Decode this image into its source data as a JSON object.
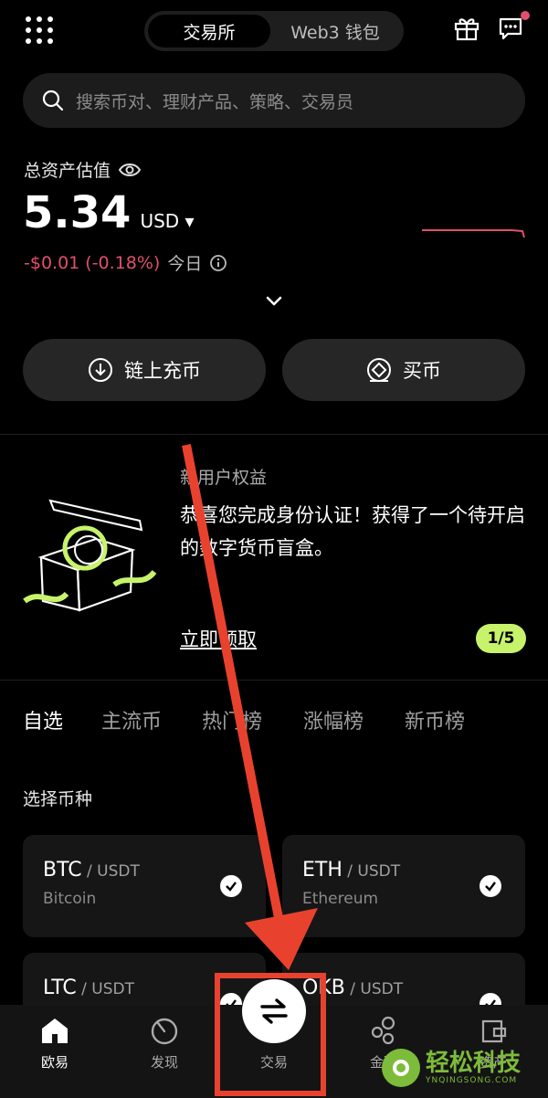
{
  "header": {
    "tabs": [
      "交易所",
      "Web3 钱包"
    ],
    "active_tab": "交易所"
  },
  "search": {
    "placeholder": "搜索币对、理财产品、策略、交易员"
  },
  "assets": {
    "title": "总资产估值",
    "value": "5.34",
    "currency": "USD",
    "change": "-$0.01 (-0.18%)",
    "period": "今日"
  },
  "actions": {
    "deposit": "链上充币",
    "buy": "买币"
  },
  "promo": {
    "subtitle": "新用户权益",
    "text": "恭喜您完成身份认证！获得了一个待开启的数字货币盲盒。",
    "link": "立即领取",
    "pager": "1/5"
  },
  "tabs": [
    "自选",
    "主流币",
    "热门榜",
    "涨幅榜",
    "新币榜"
  ],
  "section_title": "选择币种",
  "coins": [
    {
      "symbol": "BTC",
      "quote": " / USDT",
      "name": "Bitcoin"
    },
    {
      "symbol": "ETH",
      "quote": " / USDT",
      "name": "Ethereum"
    },
    {
      "symbol": "LTC",
      "quote": " / USDT",
      "name": ""
    },
    {
      "symbol": "OKB",
      "quote": " / USDT",
      "name": ""
    }
  ],
  "nav": {
    "home": "欧易",
    "discover": "发现",
    "trade": "交易",
    "earn": "金融",
    "assets": "资产"
  },
  "watermark": {
    "main": "轻松科技",
    "sub": "YNQINGSONG.COM"
  },
  "colors": {
    "accent": "#c7f36a",
    "negative": "#e0506e",
    "annotation": "#e8422e"
  }
}
